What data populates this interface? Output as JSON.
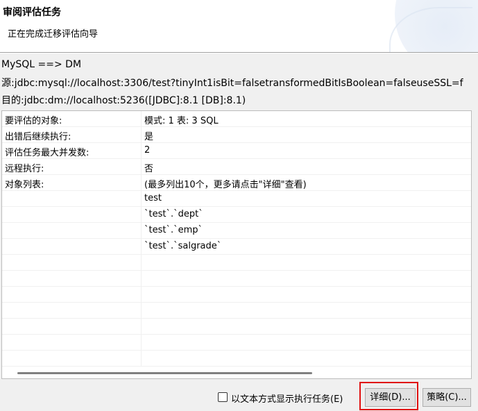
{
  "header": {
    "title": "审阅评估任务",
    "subtitle": "正在完成迁移评估向导"
  },
  "info": {
    "migration": "MySQL ==> DM",
    "source": "源:jdbc:mysql://localhost:3306/test?tinyInt1isBit=falsetransformedBitIsBoolean=falseuseSSL=f",
    "target": "目的:jdbc:dm://localhost:5236([JDBC]:8.1 [DB]:8.1)"
  },
  "table": {
    "rows": [
      {
        "key": "要评估的对象:",
        "value": "模式: 1 表: 3 SQL"
      },
      {
        "key": "出错后继续执行:",
        "value": "是"
      },
      {
        "key": "评估任务最大并发数:",
        "value": "2"
      },
      {
        "key": "远程执行:",
        "value": "否"
      },
      {
        "key": "对象列表:",
        "value": "(最多列出10个，更多请点击\"详细\"查看)"
      },
      {
        "key": "",
        "value": "test"
      },
      {
        "key": "",
        "value": "`test`.`dept`"
      },
      {
        "key": "",
        "value": "`test`.`emp`"
      },
      {
        "key": "",
        "value": "`test`.`salgrade`"
      }
    ]
  },
  "footer": {
    "checkbox_label": "以文本方式显示执行任务(E)",
    "checkbox_checked": false,
    "detail_button": "详细(D)...",
    "strategy_button": "策略(C)...",
    "highlight_color": "#e01010"
  }
}
